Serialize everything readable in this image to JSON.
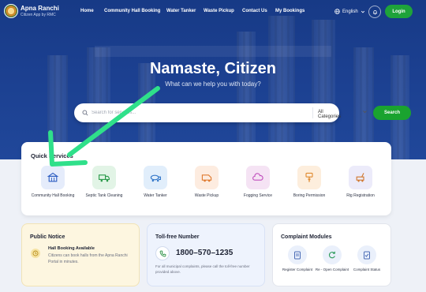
{
  "brand": {
    "title": "Apna Ranchi",
    "subtitle": "Citizen App by RMC"
  },
  "nav": {
    "links": [
      "Home",
      "Community Hall Booking",
      "Water Tanker",
      "Waste Pickup",
      "Contact Us",
      "My Bookings"
    ],
    "language": "English",
    "login_label": "Login"
  },
  "hero": {
    "title": "Namaste, Citizen",
    "subtitle": "What can we help you with today?"
  },
  "search": {
    "placeholder": "Search for services...",
    "category": "All Categories",
    "button_label": "Search"
  },
  "quick_services": {
    "title": "Quick Services",
    "items": [
      {
        "label": "Community Hall Booking",
        "icon": "building-icon",
        "color": "#e5ecfb"
      },
      {
        "label": "Septic Tank Cleaning",
        "icon": "truck-icon",
        "color": "#e2f4e6"
      },
      {
        "label": "Water Tanker",
        "icon": "tanker-icon",
        "color": "#e1eefb"
      },
      {
        "label": "Waste Pickup",
        "icon": "van-icon",
        "color": "#fdece0"
      },
      {
        "label": "Fogging Service",
        "icon": "cloud-icon",
        "color": "#f5e3f4"
      },
      {
        "label": "Boring Permission",
        "icon": "drill-icon",
        "color": "#fdeedd"
      },
      {
        "label": "Rig Registration",
        "icon": "rig-icon",
        "color": "#ecebfa"
      }
    ]
  },
  "public_notice": {
    "title": "Public Notice",
    "heading": "Hall Booking Available",
    "body": "Citizens can book halls from the Apna Ranchi Portal in minutes."
  },
  "toll_free": {
    "title": "Toll-free Number",
    "number": "1800–570–1235",
    "body": "For all municipal complaints, please call the toll-free number provided above."
  },
  "complaints": {
    "title": "Complaint Modules",
    "items": [
      {
        "label": "Register Complaint",
        "icon": "clipboard-icon"
      },
      {
        "label": "Re - Open Complaint",
        "icon": "refresh-icon"
      },
      {
        "label": "Complaint Status",
        "icon": "status-icon"
      }
    ]
  },
  "colors": {
    "primary": "#1b3f8f",
    "accent": "#1ea33a",
    "annotation": "#2fe08a"
  }
}
